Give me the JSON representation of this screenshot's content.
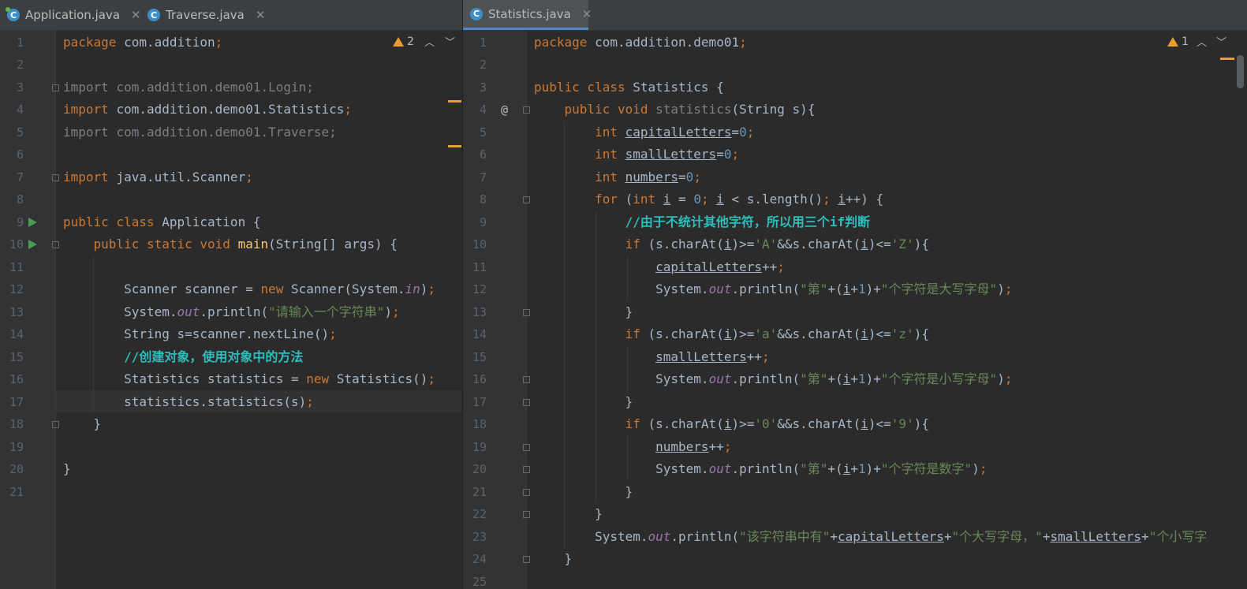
{
  "left": {
    "tabs": [
      {
        "label": "Application.java",
        "icon": "java-class-icon",
        "active": false
      },
      {
        "label": "Traverse.java",
        "icon": "java-class-icon",
        "active": false
      }
    ],
    "warnings": "2",
    "line_numbers": [
      "1",
      "2",
      "3",
      "4",
      "5",
      "6",
      "7",
      "8",
      "9",
      "10",
      "11",
      "12",
      "13",
      "14",
      "15",
      "16",
      "17",
      "18",
      "19",
      "20",
      "21"
    ],
    "current_line": "17",
    "lines": [
      [
        [
          "kw",
          "package "
        ],
        [
          "",
          "com.addition"
        ],
        [
          "kw",
          ";"
        ]
      ],
      [],
      [
        [
          "dim",
          "import com.addition.demo01.Login;"
        ]
      ],
      [
        [
          "kw",
          "import "
        ],
        [
          "",
          "com.addition.demo01.Statistics"
        ],
        [
          "kw",
          ";"
        ]
      ],
      [
        [
          "dim",
          "import com.addition.demo01.Traverse;"
        ]
      ],
      [],
      [
        [
          "kw",
          "import "
        ],
        [
          "",
          "java.util.Scanner"
        ],
        [
          "kw",
          ";"
        ]
      ],
      [],
      [
        [
          "kw",
          "public class "
        ],
        [
          "",
          "Application {"
        ]
      ],
      [
        [
          "kw",
          "    public static void "
        ],
        [
          "fn",
          "main"
        ],
        [
          "",
          "(String[] args) {"
        ]
      ],
      [],
      [
        [
          "",
          "        Scanner scanner = "
        ],
        [
          "kw",
          "new "
        ],
        [
          "",
          "Scanner(System."
        ],
        [
          "fld",
          "in"
        ],
        [
          "",
          ")"
        ],
        [
          "kw",
          ";"
        ]
      ],
      [
        [
          "",
          "        System."
        ],
        [
          "fld",
          "out"
        ],
        [
          "",
          ".println("
        ],
        [
          "str",
          "\"请输入一个字符串\""
        ],
        [
          "",
          ")"
        ],
        [
          "kw",
          ";"
        ]
      ],
      [
        [
          "",
          "        String s=scanner.nextLine()"
        ],
        [
          "kw",
          ";"
        ]
      ],
      [
        [
          "cmt",
          "        //创建对象，使用对象中的方法"
        ]
      ],
      [
        [
          "",
          "        Statistics statistics = "
        ],
        [
          "kw",
          "new "
        ],
        [
          "",
          "Statistics()"
        ],
        [
          "kw",
          ";"
        ]
      ],
      [
        [
          "",
          "        statistics.statistics(s)"
        ],
        [
          "kw",
          ";"
        ]
      ],
      [
        [
          "",
          "    }"
        ]
      ],
      [],
      [
        [
          "",
          "}"
        ]
      ],
      []
    ]
  },
  "right": {
    "tabs": [
      {
        "label": "Statistics.java",
        "icon": "java-class-icon",
        "active": true
      }
    ],
    "warnings": "1",
    "override_marker": "@",
    "line_numbers": [
      "1",
      "2",
      "3",
      "4",
      "5",
      "6",
      "7",
      "8",
      "9",
      "10",
      "11",
      "12",
      "13",
      "14",
      "15",
      "16",
      "17",
      "18",
      "19",
      "20",
      "21",
      "22",
      "23",
      "24",
      "25"
    ],
    "lines": [
      [
        [
          "kw",
          "package "
        ],
        [
          "",
          "com.addition.demo01"
        ],
        [
          "kw",
          ";"
        ]
      ],
      [],
      [
        [
          "kw",
          "public class "
        ],
        [
          "",
          "Statistics {"
        ]
      ],
      [
        [
          "kw",
          "    public void "
        ],
        [
          "dec",
          "statistics"
        ],
        [
          "",
          "(String s){"
        ]
      ],
      [
        [
          "kw",
          "        int "
        ],
        [
          "u",
          "capitalLetters"
        ],
        [
          "",
          "="
        ],
        [
          "num",
          "0"
        ],
        [
          "kw",
          ";"
        ]
      ],
      [
        [
          "kw",
          "        int "
        ],
        [
          "u",
          "smallLetters"
        ],
        [
          "",
          "="
        ],
        [
          "num",
          "0"
        ],
        [
          "kw",
          ";"
        ]
      ],
      [
        [
          "kw",
          "        int "
        ],
        [
          "u",
          "numbers"
        ],
        [
          "",
          "="
        ],
        [
          "num",
          "0"
        ],
        [
          "kw",
          ";"
        ]
      ],
      [
        [
          "kw",
          "        for "
        ],
        [
          "",
          "("
        ],
        [
          "kw",
          "int "
        ],
        [
          "u",
          "i"
        ],
        [
          "",
          " = "
        ],
        [
          "num",
          "0"
        ],
        [
          "kw",
          "; "
        ],
        [
          "u",
          "i"
        ],
        [
          "",
          " < s.length()"
        ],
        [
          "kw",
          "; "
        ],
        [
          "u",
          "i"
        ],
        [
          "",
          "++) {"
        ]
      ],
      [
        [
          "cmt",
          "            //由于不统计其他字符，所以用三个if判断"
        ]
      ],
      [
        [
          "kw",
          "            if "
        ],
        [
          "",
          "(s.charAt("
        ],
        [
          "u",
          "i"
        ],
        [
          "",
          ")>="
        ],
        [
          "str",
          "'A'"
        ],
        [
          "",
          "&&s.charAt("
        ],
        [
          "u",
          "i"
        ],
        [
          "",
          ")<="
        ],
        [
          "str",
          "'Z'"
        ],
        [
          "",
          "){"
        ]
      ],
      [
        [
          "",
          "                "
        ],
        [
          "u",
          "capitalLetters"
        ],
        [
          "",
          "++"
        ],
        [
          "kw",
          ";"
        ]
      ],
      [
        [
          "",
          "                System."
        ],
        [
          "fld",
          "out"
        ],
        [
          "",
          ".println("
        ],
        [
          "str",
          "\"第\""
        ],
        [
          "",
          "+("
        ],
        [
          "u",
          "i"
        ],
        [
          "",
          "+"
        ],
        [
          "num",
          "1"
        ],
        [
          "",
          ")+"
        ],
        [
          "str",
          "\"个字符是大写字母\""
        ],
        [
          "",
          ")"
        ],
        [
          "kw",
          ";"
        ]
      ],
      [
        [
          "",
          "            }"
        ]
      ],
      [
        [
          "kw",
          "            if "
        ],
        [
          "",
          "(s.charAt("
        ],
        [
          "u",
          "i"
        ],
        [
          "",
          ")>="
        ],
        [
          "str",
          "'a'"
        ],
        [
          "",
          "&&s.charAt("
        ],
        [
          "u",
          "i"
        ],
        [
          "",
          ")<="
        ],
        [
          "str",
          "'z'"
        ],
        [
          "",
          "){"
        ]
      ],
      [
        [
          "",
          "                "
        ],
        [
          "u",
          "smallLetters"
        ],
        [
          "",
          "++"
        ],
        [
          "kw",
          ";"
        ]
      ],
      [
        [
          "",
          "                System."
        ],
        [
          "fld",
          "out"
        ],
        [
          "",
          ".println("
        ],
        [
          "str",
          "\"第\""
        ],
        [
          "",
          "+("
        ],
        [
          "u",
          "i"
        ],
        [
          "",
          "+"
        ],
        [
          "num",
          "1"
        ],
        [
          "",
          ")+"
        ],
        [
          "str",
          "\"个字符是小写字母\""
        ],
        [
          "",
          ")"
        ],
        [
          "kw",
          ";"
        ]
      ],
      [
        [
          "",
          "            }"
        ]
      ],
      [
        [
          "kw",
          "            if "
        ],
        [
          "",
          "(s.charAt("
        ],
        [
          "u",
          "i"
        ],
        [
          "",
          ")>="
        ],
        [
          "str",
          "'0'"
        ],
        [
          "",
          "&&s.charAt("
        ],
        [
          "u",
          "i"
        ],
        [
          "",
          ")<="
        ],
        [
          "str",
          "'9'"
        ],
        [
          "",
          "){"
        ]
      ],
      [
        [
          "",
          "                "
        ],
        [
          "u",
          "numbers"
        ],
        [
          "",
          "++"
        ],
        [
          "kw",
          ";"
        ]
      ],
      [
        [
          "",
          "                System."
        ],
        [
          "fld",
          "out"
        ],
        [
          "",
          ".println("
        ],
        [
          "str",
          "\"第\""
        ],
        [
          "",
          "+("
        ],
        [
          "u",
          "i"
        ],
        [
          "",
          "+"
        ],
        [
          "num",
          "1"
        ],
        [
          "",
          ")+"
        ],
        [
          "str",
          "\"个字符是数字\""
        ],
        [
          "",
          ")"
        ],
        [
          "kw",
          ";"
        ]
      ],
      [
        [
          "",
          "            }"
        ]
      ],
      [
        [
          "",
          "        }"
        ]
      ],
      [
        [
          "",
          "        System."
        ],
        [
          "fld",
          "out"
        ],
        [
          "",
          ".println("
        ],
        [
          "str",
          "\"该字符串中有\""
        ],
        [
          "",
          "+"
        ],
        [
          "u",
          "capitalLetters"
        ],
        [
          "",
          "+"
        ],
        [
          "str",
          "\"个大写字母，\""
        ],
        [
          "",
          "+"
        ],
        [
          "u",
          "smallLetters"
        ],
        [
          "",
          "+"
        ],
        [
          "str",
          "\"个小写字"
        ]
      ],
      [
        [
          "",
          "    }"
        ]
      ],
      []
    ]
  }
}
